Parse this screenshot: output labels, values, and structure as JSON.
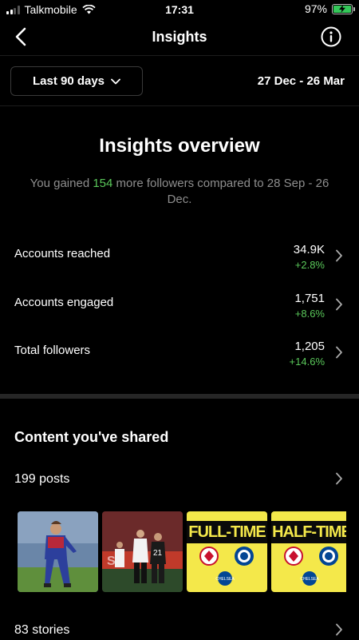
{
  "status_bar": {
    "carrier": "Talkmobile",
    "time": "17:31",
    "battery": "97%"
  },
  "nav": {
    "title": "Insights",
    "back_icon": "chevron-left-icon",
    "info_icon": "info-icon"
  },
  "date_filter": {
    "selected": "Last 90 days",
    "range": "27 Dec - 26 Mar"
  },
  "overview": {
    "title": "Insights overview",
    "subtitle_before": "You gained ",
    "gained": "154",
    "subtitle_after": " more followers compared to 28 Sep - 26 Dec."
  },
  "metrics": [
    {
      "label": "Accounts reached",
      "value": "34.9K",
      "change": "+2.8%"
    },
    {
      "label": "Accounts engaged",
      "value": "1,751",
      "change": "+8.6%"
    },
    {
      "label": "Total followers",
      "value": "1,205",
      "change": "+14.6%"
    }
  ],
  "content": {
    "title": "Content you've shared",
    "posts": "199 posts",
    "stories": "83 stories",
    "thumbnails": [
      {
        "kind": "photo",
        "text": ""
      },
      {
        "kind": "photo",
        "text": ""
      },
      {
        "kind": "graphic",
        "text": "FULL-TIME"
      },
      {
        "kind": "graphic",
        "text": "HALF-TIME"
      }
    ]
  },
  "colors": {
    "background": "#000000",
    "positive": "#5ac85a",
    "muted": "#8e8e8e",
    "graphic_yellow": "#f4e84a"
  }
}
